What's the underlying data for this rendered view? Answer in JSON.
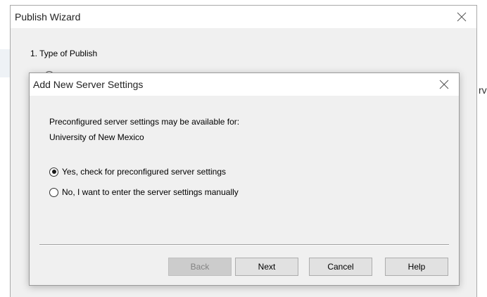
{
  "wizard": {
    "title": "Publish Wizard",
    "step_label": "1.  Type of Publish",
    "close_icon": "close-icon"
  },
  "background": {
    "fragment_text": "rv"
  },
  "dialog": {
    "title": "Add New Server Settings",
    "close_icon": "close-icon",
    "info_line_1": "Preconfigured server settings may be available for:",
    "info_line_2": "University of New Mexico",
    "options": [
      {
        "label": "Yes, check for preconfigured server settings",
        "selected": true
      },
      {
        "label": "No, I want to enter the server settings manually",
        "selected": false
      }
    ],
    "buttons": {
      "back": "Back",
      "next": "Next",
      "cancel": "Cancel",
      "help": "Help"
    }
  }
}
